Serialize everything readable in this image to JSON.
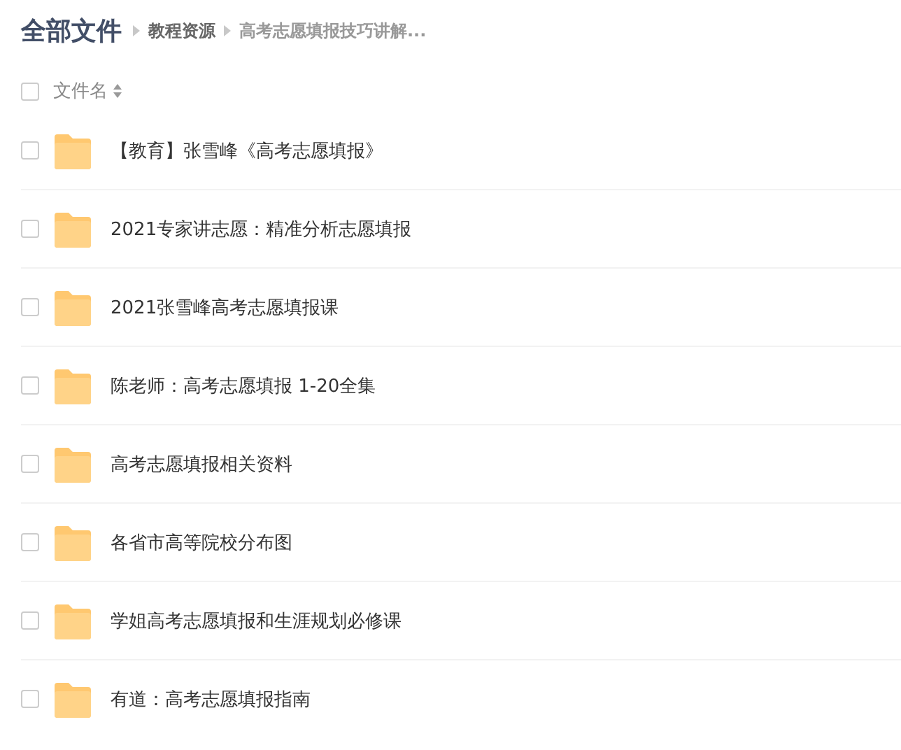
{
  "breadcrumb": {
    "root": "全部文件",
    "items": [
      {
        "label": "教程资源",
        "current": false
      },
      {
        "label": "高考志愿填报技巧讲解...",
        "current": true
      }
    ]
  },
  "header": {
    "checked": false,
    "column": "文件名"
  },
  "rows": [
    {
      "name": "【教育】张雪峰《高考志愿填报》",
      "checked": false
    },
    {
      "name": "2021专家讲志愿：精准分析志愿填报",
      "checked": false
    },
    {
      "name": "2021张雪峰高考志愿填报课",
      "checked": false
    },
    {
      "name": "陈老师：高考志愿填报 1-20全集",
      "checked": false
    },
    {
      "name": "高考志愿填报相关资料",
      "checked": false
    },
    {
      "name": "各省市高等院校分布图",
      "checked": false
    },
    {
      "name": "学姐高考志愿填报和生涯规划必修课",
      "checked": false
    },
    {
      "name": "有道：高考志愿填报指南",
      "checked": false
    }
  ]
}
